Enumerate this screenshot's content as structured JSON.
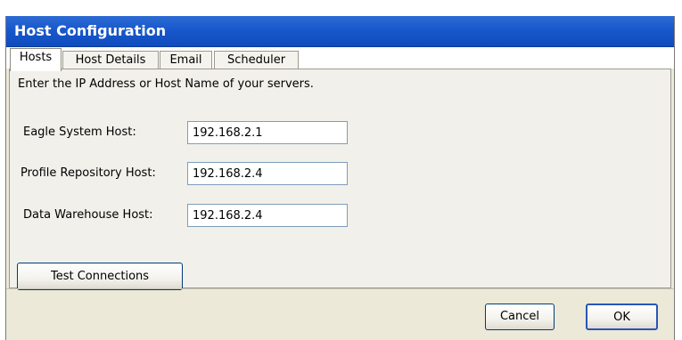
{
  "window": {
    "title": "Host Configuration"
  },
  "tabs": [
    {
      "label": "Hosts",
      "active": true
    },
    {
      "label": "Host Details",
      "active": false
    },
    {
      "label": "Email",
      "active": false
    },
    {
      "label": "Scheduler",
      "active": false
    }
  ],
  "hosts_panel": {
    "intro": "Enter the IP Address or Host Name of your servers.",
    "fields": [
      {
        "label": "Eagle System Host:",
        "value": "192.168.2.1"
      },
      {
        "label": "Profile Repository Host:",
        "value": "192.168.2.4"
      },
      {
        "label": "Data Warehouse Host:",
        "value": "192.168.2.4"
      }
    ],
    "test_button": "Test Connections"
  },
  "footer": {
    "cancel": "Cancel",
    "ok": "OK"
  },
  "colors": {
    "titlebar": "#1858cc",
    "title_text": "#ffffff",
    "dialog_bg": "#ece9d8",
    "panel_bg": "#f1f0ea",
    "input_border": "#7f9db9"
  }
}
